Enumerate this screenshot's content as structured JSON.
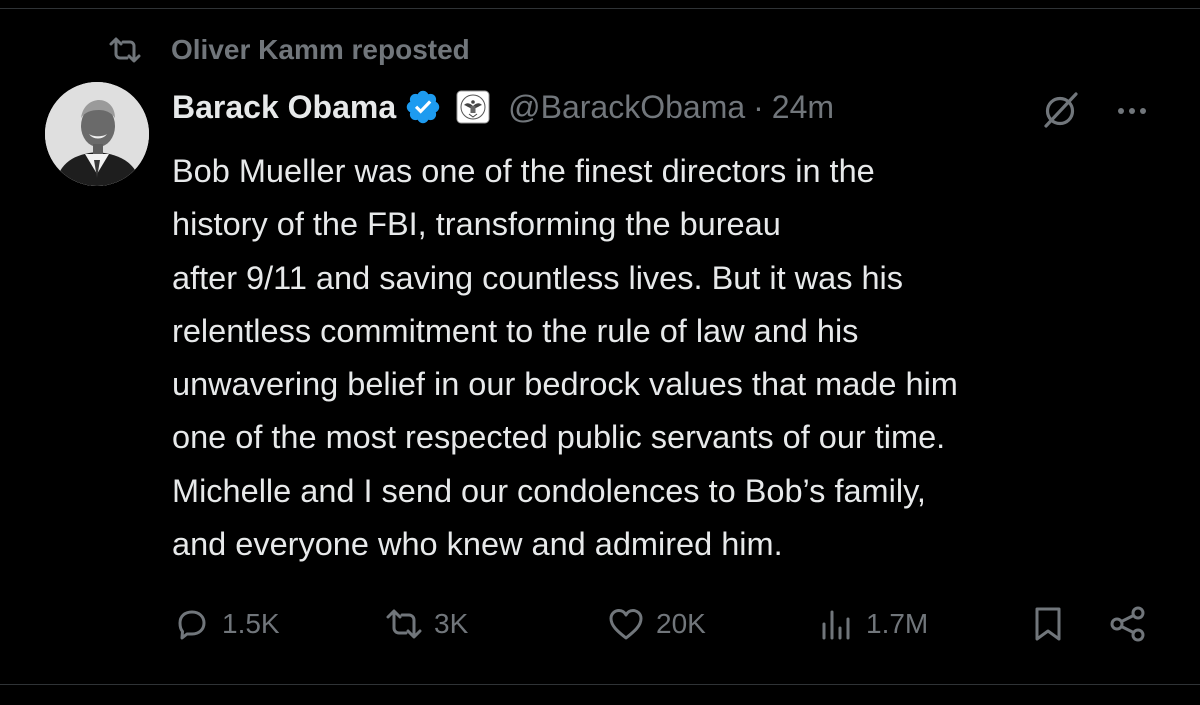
{
  "repost_banner": {
    "icon": "repost-icon",
    "text": "Oliver Kamm reposted"
  },
  "author": {
    "name": "Barack Obama",
    "verified_icon": "verified-badge-icon",
    "affiliation_icon": "government-seal-icon",
    "handle": "@BarackObama",
    "separator": "·",
    "time": "24m",
    "accent_color": "#1d9bf0"
  },
  "tweet": {
    "lines": [
      "Bob Mueller was one of the finest directors in the",
      "history of the FBI, transforming the bureau",
      "after 9/11 and saving countless lives. But it was his",
      "relentless commitment to the rule of law and his",
      "unwavering belief in our bedrock values that made him",
      "one of the most respected public servants of our time.",
      "Michelle and I send our condolences to Bob’s family,",
      "and everyone who knew and admired him."
    ]
  },
  "actions": {
    "reply": {
      "icon": "reply-icon",
      "count": "1.5K"
    },
    "repost": {
      "icon": "repost-icon",
      "count": "3K"
    },
    "like": {
      "icon": "heart-icon",
      "count": "20K"
    },
    "views": {
      "icon": "views-chart-icon",
      "count": "1.7M"
    },
    "bookmark": {
      "icon": "bookmark-icon"
    },
    "share": {
      "icon": "share-icon"
    }
  },
  "top_right": {
    "grok_icon": "grok-icon",
    "more_icon": "more-options-icon"
  },
  "colors": {
    "background": "#000000",
    "text_primary": "#e7e9ea",
    "text_secondary": "#71767b",
    "divider": "#2f3336"
  }
}
